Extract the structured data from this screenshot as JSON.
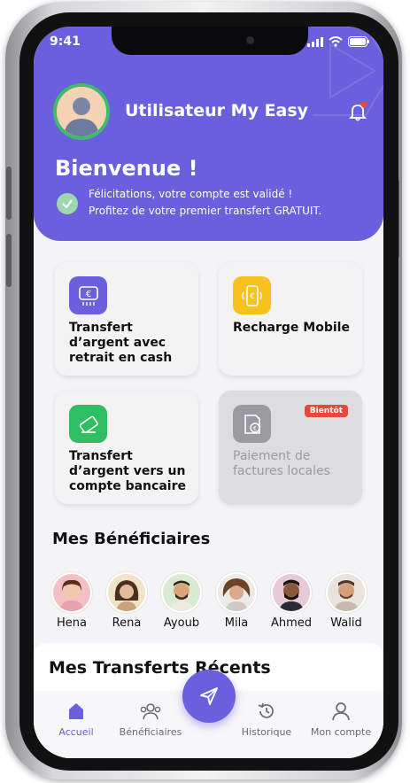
{
  "status_bar": {
    "time": "9:41"
  },
  "header": {
    "username": "Utilisateur My Easy",
    "welcome": "Bienvenue !",
    "message_line1": "Félicitations, votre compte est validé !",
    "message_line2": "Profitez de votre premier transfert GRATUIT."
  },
  "services": [
    {
      "label": "Transfert d’argent avec retrait en cash",
      "icon": "cash-transfer-icon",
      "color": "#6a60dd"
    },
    {
      "label": "Recharge Mobile",
      "icon": "mobile-recharge-icon",
      "color": "#f7c21e"
    },
    {
      "label": "Transfert d’argent vers un compte bancaire",
      "icon": "bank-transfer-icon",
      "color": "#2fbf62"
    },
    {
      "label": "Paiement de factures locales",
      "icon": "bill-payment-icon",
      "color": "#9a9aa0",
      "badge": "Bientôt"
    }
  ],
  "beneficiaries": {
    "title": "Mes Bénéficiaires",
    "items": [
      {
        "name": "Hena"
      },
      {
        "name": "Rena"
      },
      {
        "name": "Ayoub"
      },
      {
        "name": "Mila"
      },
      {
        "name": "Ahmed"
      },
      {
        "name": "Walid"
      }
    ]
  },
  "recent_transfers": {
    "title": "Mes Transferts Récents"
  },
  "nav": {
    "home": "Accueil",
    "beneficiaries": "Bénéficiaires",
    "history": "Historique",
    "account": "Mon compte"
  },
  "colors": {
    "primary": "#6a60dd",
    "success": "#3fbb6c",
    "badge": "#e24a3b"
  }
}
